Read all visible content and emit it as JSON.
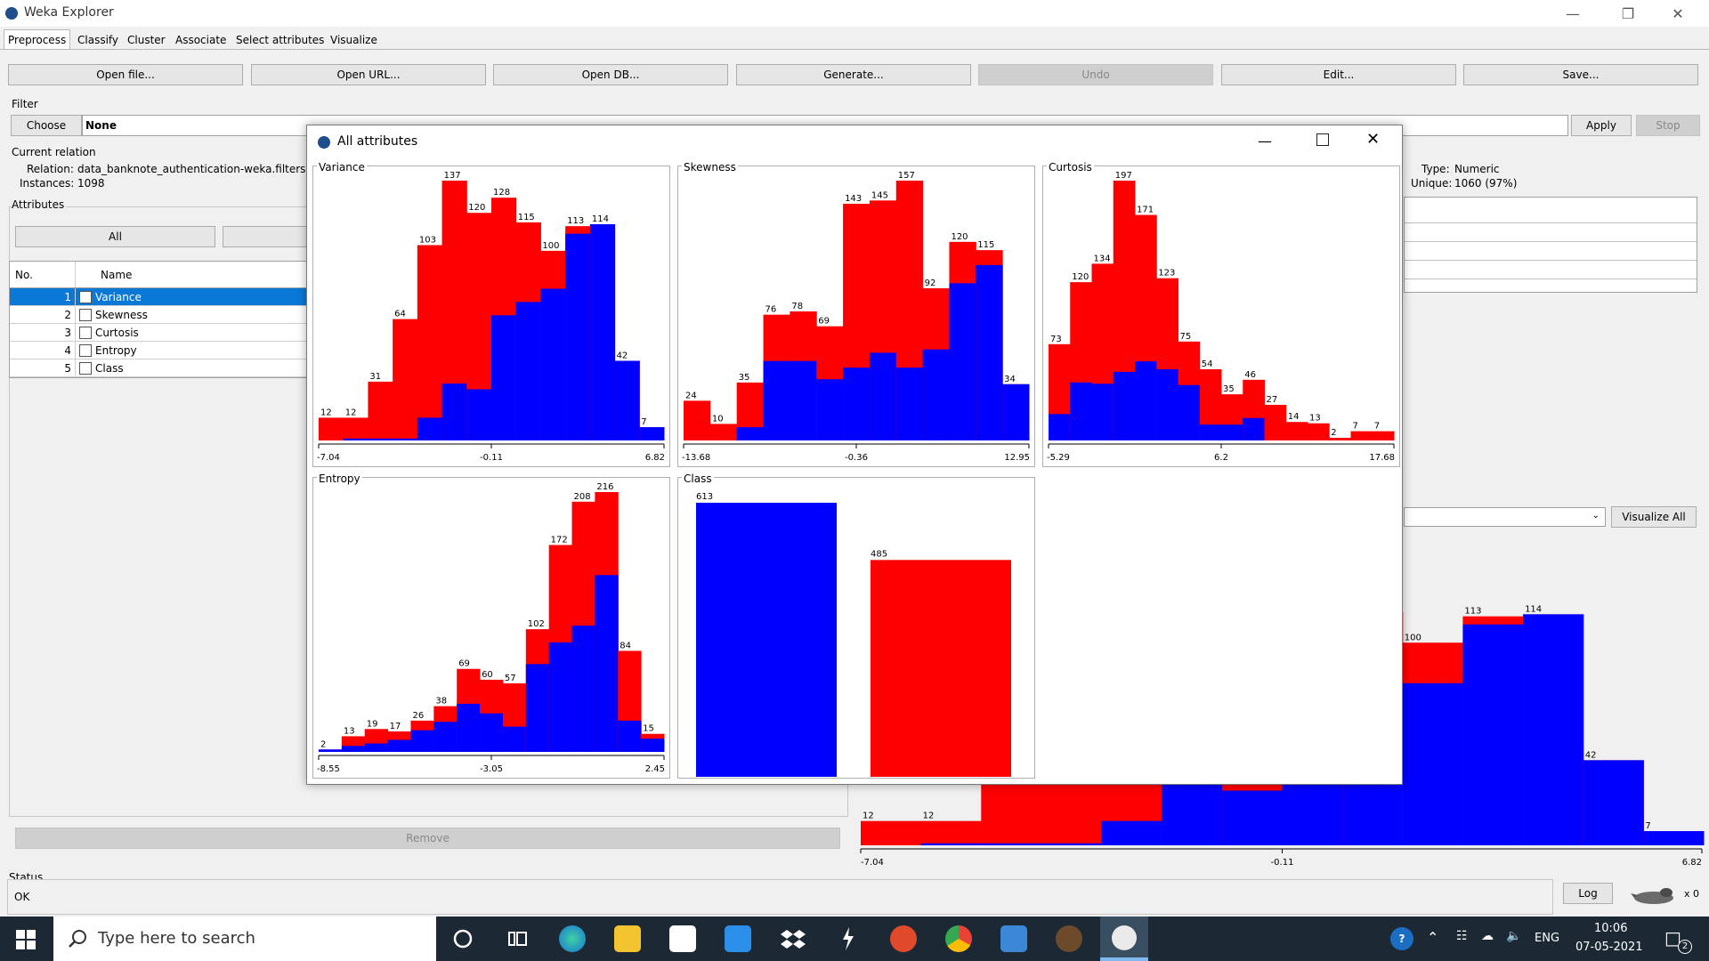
{
  "window": {
    "title": "Weka Explorer"
  },
  "tabs": [
    "Preprocess",
    "Classify",
    "Cluster",
    "Associate",
    "Select attributes",
    "Visualize"
  ],
  "toolbar": [
    "Open file...",
    "Open URL...",
    "Open DB...",
    "Generate...",
    "Undo",
    "Edit...",
    "Save..."
  ],
  "filter": {
    "section": "Filter",
    "choose": "Choose",
    "value": "None",
    "apply": "Apply",
    "stop": "Stop"
  },
  "relation": {
    "section": "Current relation",
    "relation_label": "Relation:",
    "relation_value": "data_banknote_authentication-weka.filters.un",
    "instances_label": "Instances:",
    "instances_value": "1098"
  },
  "attributes": {
    "section": "Attributes",
    "all_button": "All",
    "col_no": "No.",
    "col_name": "Name",
    "rows": [
      {
        "no": "1",
        "name": "Variance"
      },
      {
        "no": "2",
        "name": "Skewness"
      },
      {
        "no": "3",
        "name": "Curtosis"
      },
      {
        "no": "4",
        "name": "Entropy"
      },
      {
        "no": "5",
        "name": "Class"
      }
    ],
    "remove": "Remove"
  },
  "selected_attr": {
    "type_label": "Type:",
    "type_value": "Numeric",
    "unique_label": "Unique:",
    "unique_value": "1060 (97%)"
  },
  "visualize_all": "Visualize All",
  "status": {
    "section": "Status",
    "text": "OK",
    "log": "Log",
    "count": "x 0"
  },
  "dialog": {
    "title": "All attributes"
  },
  "colors": {
    "class_a": "#0000ff",
    "class_b": "#ff0000",
    "selection": "#0a78d7"
  },
  "chart_data": [
    {
      "type": "bar",
      "title": "Variance",
      "tick_labels": [
        "-7.04",
        "-0.11",
        "6.82"
      ],
      "totals": [
        12,
        12,
        31,
        64,
        103,
        137,
        120,
        128,
        115,
        100,
        113,
        114,
        42,
        7
      ],
      "blue": [
        0,
        1,
        1,
        1,
        12,
        30,
        27,
        66,
        73,
        80,
        109,
        114,
        42,
        7
      ]
    },
    {
      "type": "bar",
      "title": "Skewness",
      "tick_labels": [
        "-13.68",
        "-0.36",
        "12.95"
      ],
      "totals": [
        24,
        10,
        35,
        76,
        78,
        69,
        143,
        145,
        157,
        92,
        120,
        115,
        34
      ],
      "blue": [
        0,
        0,
        8,
        48,
        48,
        37,
        44,
        53,
        44,
        55,
        95,
        106,
        34
      ]
    },
    {
      "type": "bar",
      "title": "Curtosis",
      "tick_labels": [
        "-5.29",
        "6.2",
        "17.68"
      ],
      "totals": [
        73,
        120,
        134,
        197,
        171,
        123,
        75,
        54,
        35,
        46,
        27,
        14,
        13,
        2,
        7,
        7
      ],
      "blue": [
        20,
        44,
        43,
        52,
        60,
        54,
        42,
        12,
        12,
        17,
        0,
        0,
        0,
        0,
        0,
        0
      ]
    },
    {
      "type": "bar",
      "title": "Entropy",
      "tick_labels": [
        "-8.55",
        "-3.05",
        "2.45"
      ],
      "totals": [
        2,
        13,
        19,
        17,
        26,
        38,
        69,
        60,
        57,
        102,
        172,
        208,
        216,
        84,
        15
      ],
      "blue": [
        2,
        5,
        7,
        10,
        18,
        25,
        40,
        32,
        21,
        73,
        91,
        105,
        147,
        26,
        11
      ]
    },
    {
      "type": "bar",
      "title": "Class",
      "categories": [
        "",
        ""
      ],
      "values": [
        613,
        485
      ]
    }
  ],
  "background_histogram": {
    "tick_labels": [
      "-7.04",
      "-0.11",
      "6.82"
    ],
    "totals": [
      12,
      12,
      31,
      64,
      103,
      137,
      120,
      128,
      115,
      100,
      113,
      114,
      42,
      7
    ],
    "blue": [
      0,
      1,
      1,
      1,
      12,
      30,
      27,
      66,
      73,
      80,
      109,
      114,
      42,
      7
    ],
    "visible_labels": [
      "12",
      "12",
      "100",
      "113",
      "114",
      "42",
      "7"
    ]
  },
  "taskbar": {
    "search_placeholder": "Type here to search",
    "time": "10:06",
    "date": "07-05-2021",
    "lang": "ENG",
    "notifications": "2"
  }
}
